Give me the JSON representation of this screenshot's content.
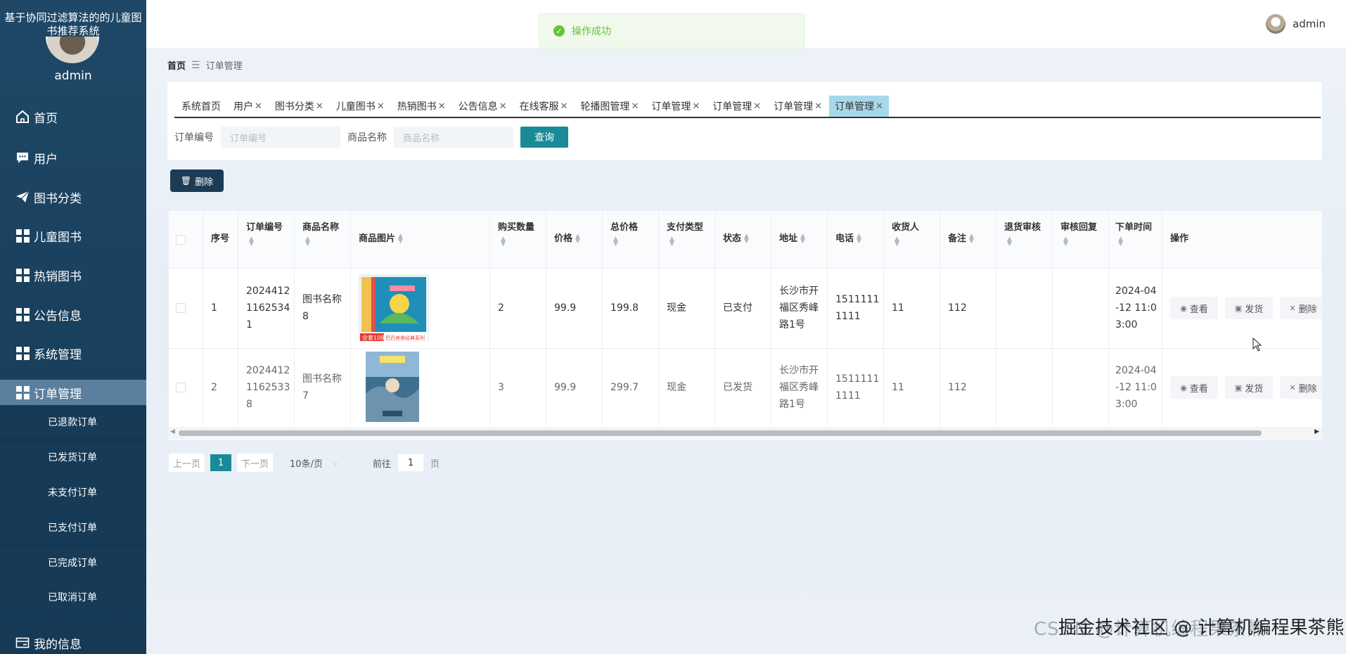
{
  "app": {
    "title": "基于协同过滤算法的的儿童图书推荐系统",
    "user": "admin"
  },
  "sidebar": {
    "items": [
      {
        "label": "首页",
        "icon": "home-icon"
      },
      {
        "label": "用户",
        "icon": "chat-icon"
      },
      {
        "label": "图书分类",
        "icon": "send-icon"
      },
      {
        "label": "儿童图书",
        "icon": "grid-icon"
      },
      {
        "label": "热销图书",
        "icon": "grid-icon"
      },
      {
        "label": "公告信息",
        "icon": "grid-icon"
      },
      {
        "label": "系统管理",
        "icon": "grid-icon"
      },
      {
        "label": "订单管理",
        "icon": "grid-icon"
      }
    ],
    "sub_items": [
      "已退款订单",
      "已发货订单",
      "未支付订单",
      "已支付订单",
      "已完成订单",
      "已取消订单"
    ],
    "bottom_item": {
      "label": "我的信息",
      "icon": "card-icon"
    }
  },
  "toast": {
    "text": "操作成功",
    "icon": "check-circle-icon"
  },
  "breadcrumb": {
    "home": "首页",
    "current": "订单管理"
  },
  "tabs": [
    {
      "label": "系统首页",
      "closable": false
    },
    {
      "label": "用户",
      "closable": true
    },
    {
      "label": "图书分类",
      "closable": true
    },
    {
      "label": "儿童图书",
      "closable": true
    },
    {
      "label": "热销图书",
      "closable": true
    },
    {
      "label": "公告信息",
      "closable": true
    },
    {
      "label": "在线客服",
      "closable": true
    },
    {
      "label": "轮播图管理",
      "closable": true
    },
    {
      "label": "订单管理",
      "closable": true
    },
    {
      "label": "订单管理",
      "closable": true
    },
    {
      "label": "订单管理",
      "closable": true
    },
    {
      "label": "订单管理",
      "closable": true,
      "active": true
    }
  ],
  "search": {
    "order_no_label": "订单编号",
    "order_no_placeholder": "订单编号",
    "product_label": "商品名称",
    "product_placeholder": "商品名称",
    "query_button": "查询"
  },
  "toolbar": {
    "delete_button": "删除"
  },
  "table": {
    "headers": {
      "index": "序号",
      "order_no": "订单编号",
      "product_name": "商品名称",
      "product_image": "商品图片",
      "quantity": "购买数量",
      "price": "价格",
      "total": "总价格",
      "pay_type": "支付类型",
      "status": "状态",
      "address": "地址",
      "phone": "电话",
      "receiver": "收货人",
      "remark": "备注",
      "refund_review": "退货审核",
      "review_reply": "审核回复",
      "order_time": "下单时间",
      "actions": "操作"
    },
    "rows": [
      {
        "index": "1",
        "order_no": [
          "2024412",
          "1162534",
          "1"
        ],
        "product_name": [
          "图书名称",
          "8"
        ],
        "quantity": "2",
        "price": "99.9",
        "total": "199.8",
        "pay_type": "现金",
        "status": "已支付",
        "address": [
          "长沙市开",
          "福区秀峰",
          "路1号"
        ],
        "phone": [
          "1511111",
          "1111"
        ],
        "receiver": "11",
        "remark": "112",
        "refund_review": "",
        "review_reply": "",
        "order_time": [
          "2024-04",
          "-12 11:0",
          "3:00"
        ],
        "image_text": [
          "全套10册",
          "巴巴爸爸经典系列"
        ]
      },
      {
        "index": "2",
        "order_no": [
          "2024412",
          "1162533",
          "8"
        ],
        "product_name": [
          "图书名称",
          "7"
        ],
        "quantity": "3",
        "price": "99.9",
        "total": "299.7",
        "pay_type": "现金",
        "status": "已发货",
        "address": [
          "长沙市开",
          "福区秀峰",
          "路1号"
        ],
        "phone": [
          "1511111",
          "1111"
        ],
        "receiver": "11",
        "remark": "112",
        "refund_review": "",
        "review_reply": "",
        "order_time": [
          "2024-04",
          "-12 11:0",
          "3:00"
        ]
      }
    ],
    "row_actions": {
      "view": "查看",
      "ship": "发货",
      "delete": "删除"
    }
  },
  "pagination": {
    "prev": "上一页",
    "current": "1",
    "next": "下一页",
    "page_size": "10条/页",
    "goto_label": "前往",
    "goto_value": "1",
    "page_unit": "页"
  },
  "watermark": {
    "text": "掘金技术社区 @ 计算机编程果茶熊",
    "faint_text": "CSDN @计算机编程果茶熊"
  },
  "colors": {
    "sidebar": "#1f4868",
    "accent": "#1a8a97",
    "active_tab": "#a7d8ea",
    "success": "#67c23a"
  }
}
